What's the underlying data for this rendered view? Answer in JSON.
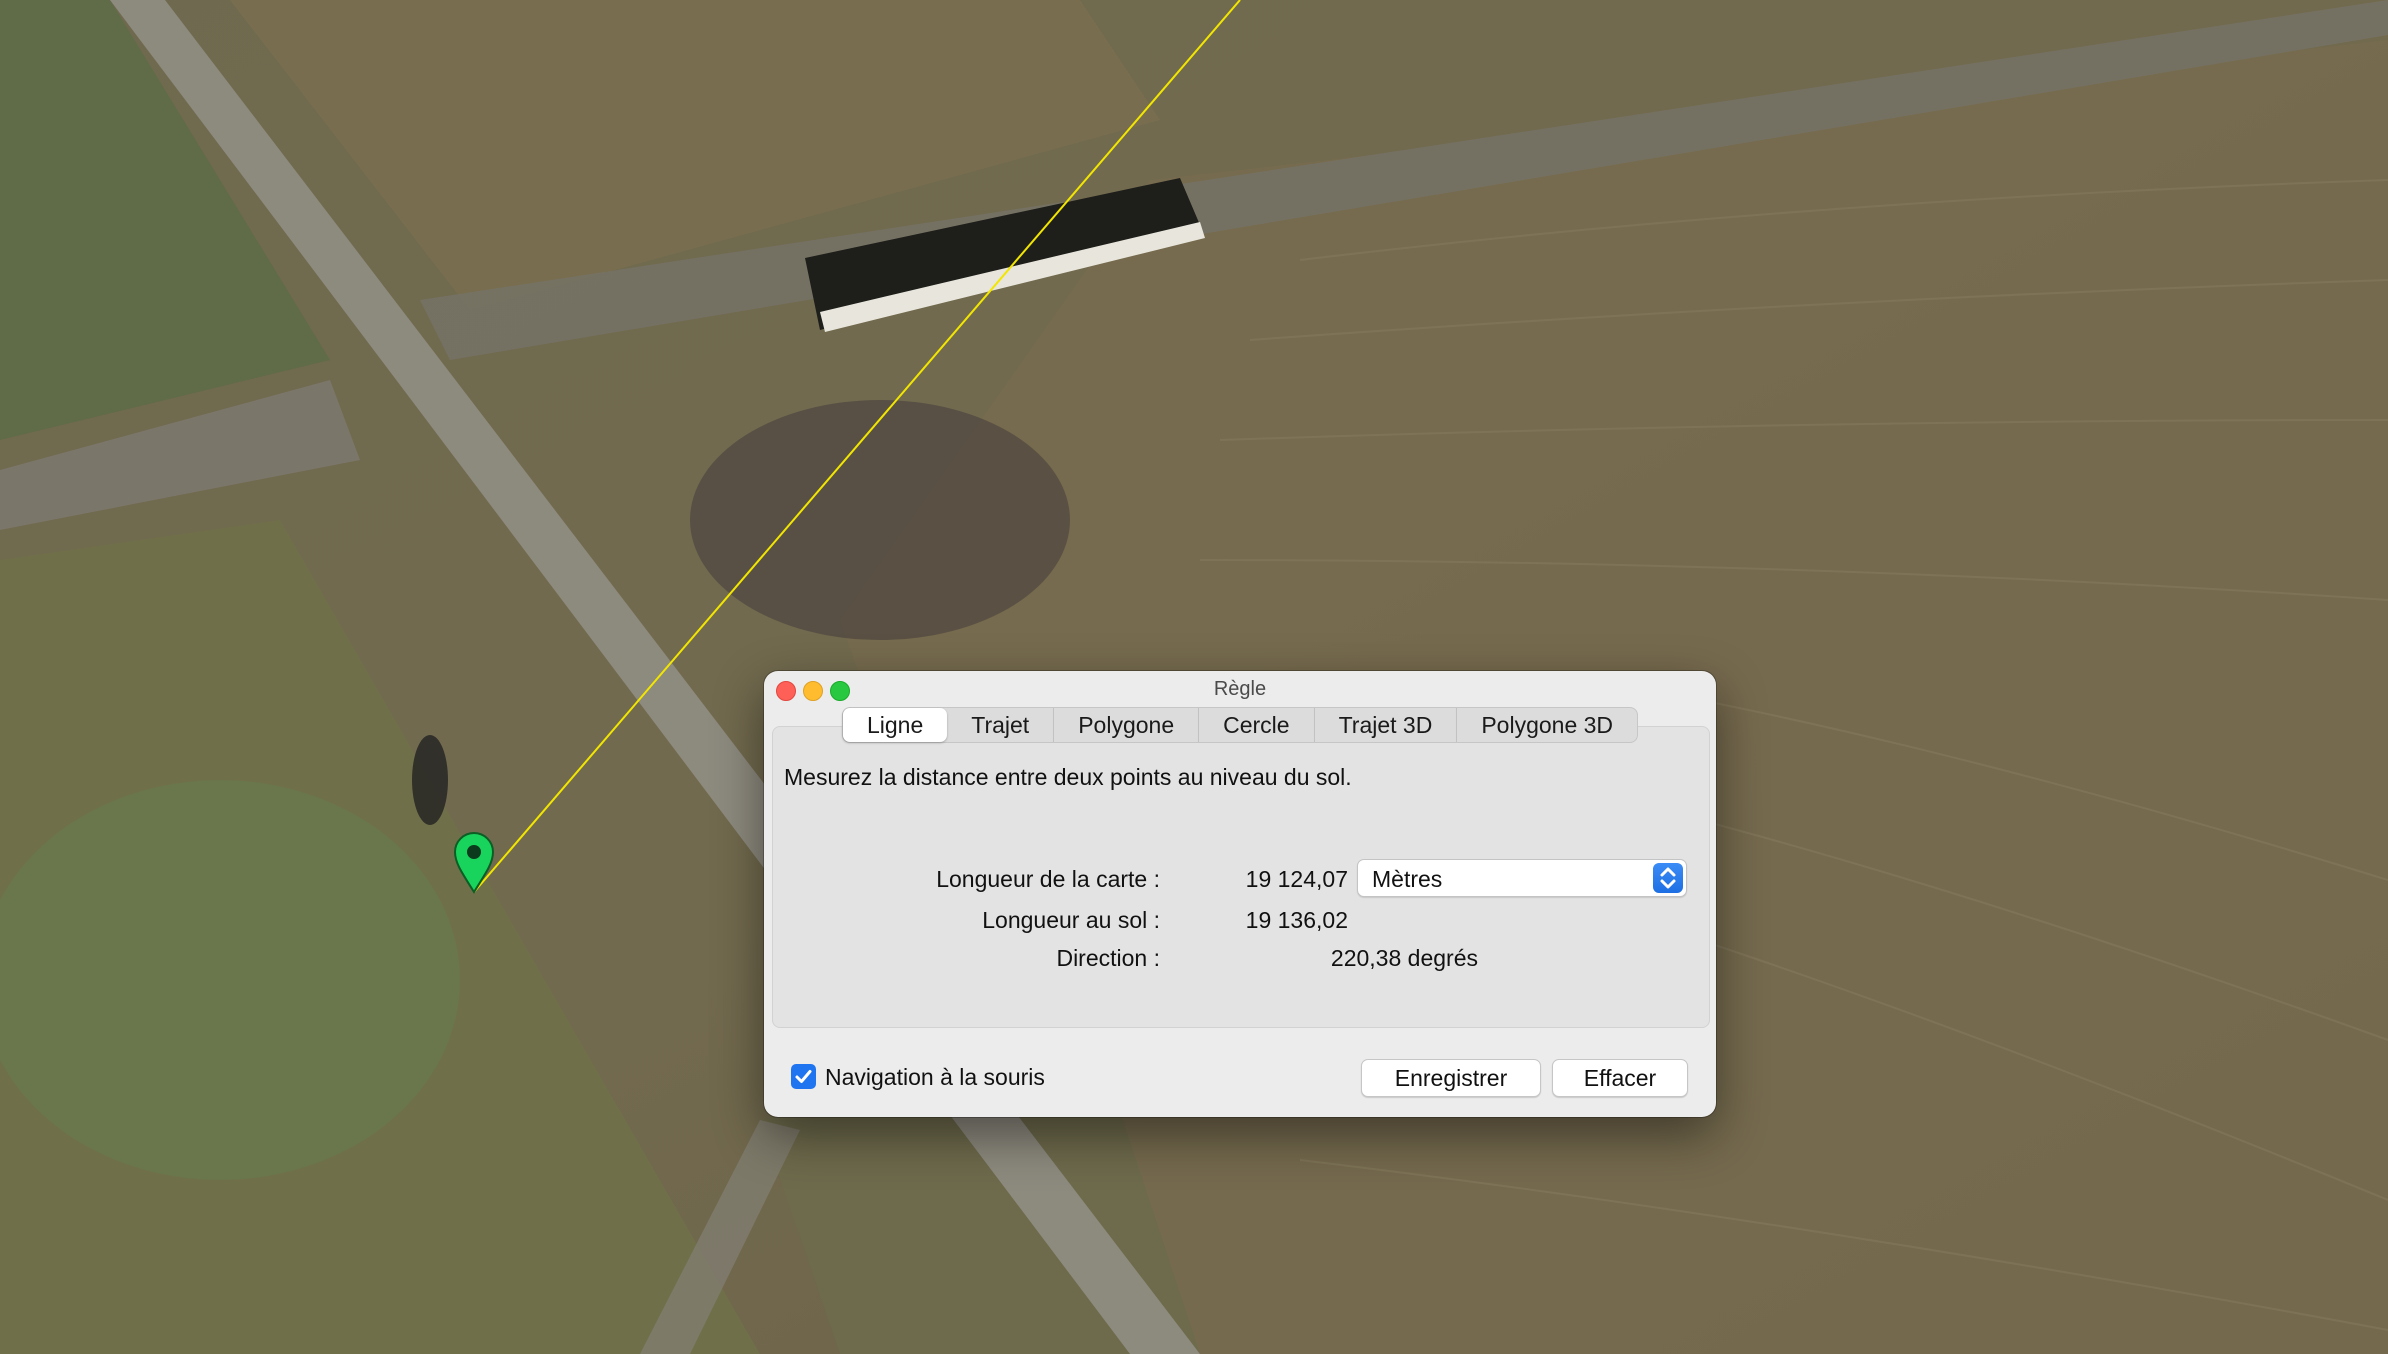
{
  "window": {
    "title": "Règle"
  },
  "tabs": [
    {
      "label": "Ligne",
      "active": true
    },
    {
      "label": "Trajet",
      "active": false
    },
    {
      "label": "Polygone",
      "active": false
    },
    {
      "label": "Cercle",
      "active": false
    },
    {
      "label": "Trajet 3D",
      "active": false
    },
    {
      "label": "Polygone 3D",
      "active": false
    }
  ],
  "description": "Mesurez la distance entre deux points au niveau du sol.",
  "measurements": {
    "map_length_label": "Longueur de la carte :",
    "map_length_value": "19 124,07",
    "ground_length_label": "Longueur au sol :",
    "ground_length_value": "19 136,02",
    "direction_label": "Direction :",
    "direction_value": "220,38 degrés"
  },
  "unit_select": {
    "selected": "Mètres",
    "icon": "chevron-updown-icon"
  },
  "mouse_navigation": {
    "label": "Navigation à la souris",
    "checked": true
  },
  "buttons": {
    "save": "Enregistrer",
    "clear": "Effacer"
  },
  "colors": {
    "accent": "#1f74f0",
    "measure_line": "#f2e600",
    "placemark": "#19d45c",
    "close": "#fe5f57",
    "minimize": "#febc2e",
    "maximize": "#28c840"
  },
  "map": {
    "placemark_icon": "map-pin-icon"
  }
}
